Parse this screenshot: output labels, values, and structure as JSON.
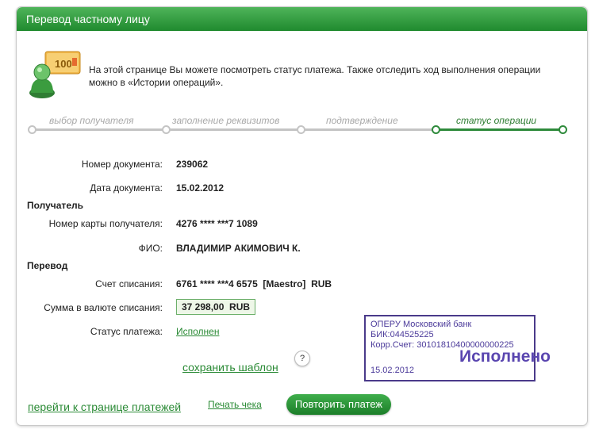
{
  "header": {
    "title": "Перевод частному лицу"
  },
  "intro": {
    "text": "На этой странице Вы можете посмотреть статус платежа. Также отследить ход выполнения операции можно в «Истории операций».",
    "icon": "money-card-icon"
  },
  "steps": [
    {
      "label": "выбор получателя",
      "active": false
    },
    {
      "label": "заполнение реквизитов",
      "active": false
    },
    {
      "label": "подтверждение",
      "active": false
    },
    {
      "label": "статус операции",
      "active": true
    }
  ],
  "details": {
    "doc_number_label": "Номер документа:",
    "doc_number": "239062",
    "doc_date_label": "Дата документа:",
    "doc_date": "15.02.2012",
    "recipient_section": "Получатель",
    "card_label": "Номер карты получателя:",
    "card_number": "4276 **** ***7 1089",
    "fio_label": "ФИО:",
    "fio": "ВЛАДИМИР АКИМОВИЧ К.",
    "transfer_section": "Перевод",
    "account_label": "Счет списания:",
    "account": "6761 **** ***4 6575  [Maestro]  RUB",
    "amount_label": "Сумма в валюте списания:",
    "amount": "37 298,00  RUB",
    "status_label": "Статус платежа:",
    "status": "Исполнен"
  },
  "stamp": {
    "line1": "ОПЕРУ Московский банк",
    "line2": "БИК:044525225",
    "line3": "Корр.Счет: 30101810400000000225",
    "status": "Исполнено",
    "date": "15.02.2012"
  },
  "actions": {
    "save_template": "сохранить шаблон",
    "help": "?",
    "go_payments": "перейти к странице платежей",
    "print_receipt": "Печать чека",
    "repeat_payment": "Повторить платеж"
  },
  "colors": {
    "brand_green": "#1f8a2e",
    "stamp_purple": "#4b3a9a"
  }
}
